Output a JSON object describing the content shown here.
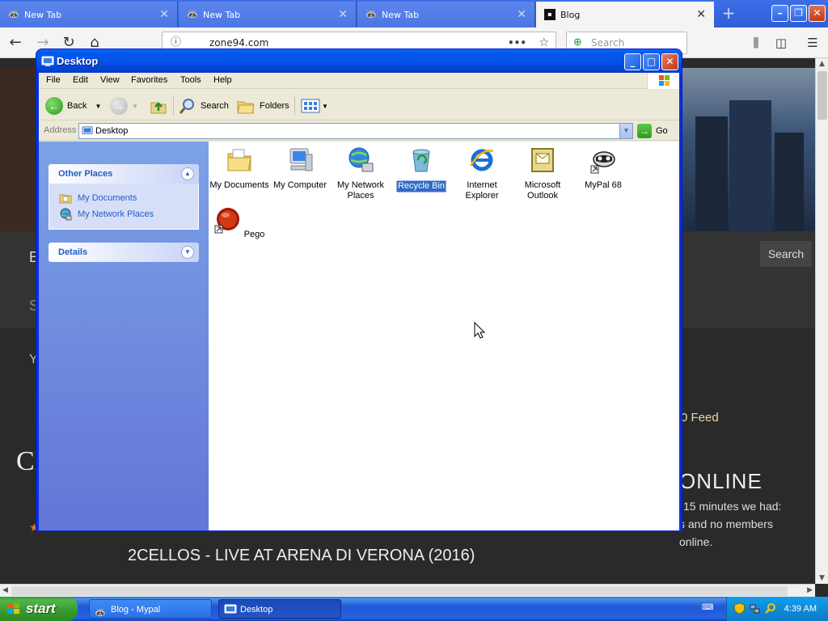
{
  "browser": {
    "tabs": [
      {
        "label": "New Tab",
        "active": false
      },
      {
        "label": "New Tab",
        "active": false
      },
      {
        "label": "New Tab",
        "active": false
      },
      {
        "label": "Blog",
        "active": true
      }
    ],
    "url": "zone94.com",
    "search_placeholder": "Search",
    "page": {
      "search_button": "Search",
      "feed_text": "0 Feed",
      "online_heading": "ONLINE",
      "online_line1": "15 minutes we had:",
      "online_line2": "s and no members",
      "online_line3": "online.",
      "post_title": "2CELLOS - LIVE AT ARENA DI VERONA (2016)",
      "partial_heading": "CE",
      "nav_partial_e": "E",
      "nav_partial_s": "S",
      "nav_partial_y": "Y"
    }
  },
  "explorer": {
    "title": "Desktop",
    "menu": [
      "File",
      "Edit",
      "View",
      "Favorites",
      "Tools",
      "Help"
    ],
    "toolbar": {
      "back": "Back",
      "search": "Search",
      "folders": "Folders"
    },
    "address_label": "Address",
    "address_value": "Desktop",
    "go_label": "Go",
    "other_places": {
      "title": "Other Places",
      "links": [
        "My Documents",
        "My Network Places"
      ]
    },
    "details": {
      "title": "Details"
    },
    "items": [
      {
        "label": "My Documents",
        "icon": "folder-documents-icon",
        "selected": false
      },
      {
        "label": "My Computer",
        "icon": "computer-icon",
        "selected": false
      },
      {
        "label": "My Network Places",
        "icon": "network-places-icon",
        "selected": false
      },
      {
        "label": "Recycle Bin",
        "icon": "recycle-bin-icon",
        "selected": true
      },
      {
        "label": "Internet Explorer",
        "icon": "internet-explorer-icon",
        "selected": false
      },
      {
        "label": "Microsoft Outlook",
        "icon": "outlook-icon",
        "selected": false
      },
      {
        "label": "MyPal 68",
        "icon": "mypal-icon",
        "selected": false
      },
      {
        "label": "Pego",
        "icon": "pego-icon",
        "selected": false
      }
    ]
  },
  "taskbar": {
    "start_label": "start",
    "tasks": [
      {
        "label": "Blog - Mypal",
        "active": false
      },
      {
        "label": "Desktop",
        "active": true
      }
    ],
    "clock": "4:39 AM"
  },
  "colors": {
    "xp_blue": "#0054e3",
    "selection": "#316ac5",
    "task_link": "#215dc6"
  }
}
